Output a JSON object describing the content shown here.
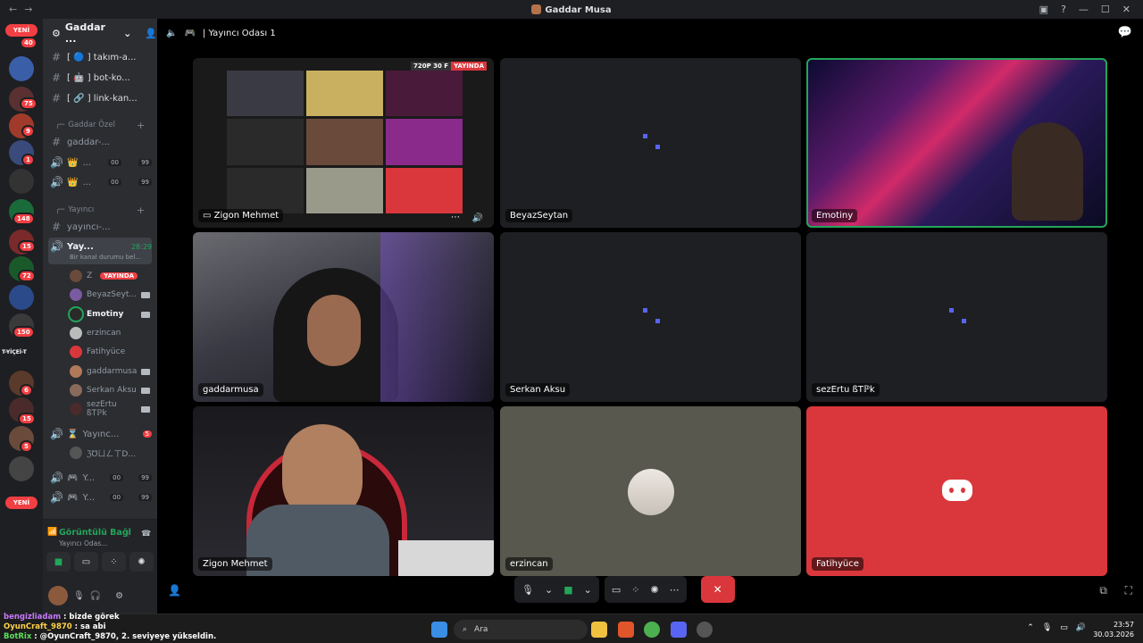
{
  "window": {
    "title": "Gaddar Musa"
  },
  "rail": {
    "new_top": "YENİ",
    "new_bottom": "YENİ",
    "badges": [
      "40",
      "75",
      "9",
      "1",
      "148",
      "15",
      "72",
      "150",
      "6",
      "15",
      "5"
    ],
    "text_server": "T-YİÇEİ-T"
  },
  "server": {
    "name": "Gaddar ...",
    "channels": [
      {
        "name": "[ 🔵 ] takım-a..."
      },
      {
        "name": "[ 🤖 ] bot-ko..."
      },
      {
        "name": "[ 🔗 ] link-kan..."
      }
    ],
    "categories": [
      {
        "label": "Gaddar Özel"
      },
      {
        "label": "Yayıncı"
      }
    ],
    "private_text": "gaddar-...",
    "private_voice": [
      {
        "label": "...",
        "count": "00",
        "cap": "99"
      },
      {
        "label": "...",
        "count": "00",
        "cap": "99"
      }
    ],
    "streamer_text": "yayıncı-...",
    "active_voice": {
      "name": "Yay...",
      "time": "28:29",
      "status": "Bir kanal durumu bel..."
    },
    "members": [
      {
        "name": "Z",
        "live": "YAYINDA"
      },
      {
        "name": "BeyazSeyt..."
      },
      {
        "name": "Emotiny"
      },
      {
        "name": "erzincan"
      },
      {
        "name": "Fatihyüce"
      },
      {
        "name": "gaddarmusa"
      },
      {
        "name": "Serkan Aksu"
      },
      {
        "name": "sezErtu ßTℙk"
      }
    ],
    "voice2": {
      "name": "Yayınc...",
      "count": "5",
      "member": "ℨ℧ㄩㄥㄒD..."
    },
    "bottom_voice": [
      {
        "label": "Y...",
        "count": "00",
        "cap": "99"
      },
      {
        "label": "Y...",
        "count": "00",
        "cap": "99"
      }
    ]
  },
  "voice_panel": {
    "status": "Görüntülü Bağl",
    "channel": "Yayıncı Odas..."
  },
  "call": {
    "channel": "| Yayıncı Odası 1",
    "stream_quality": "720P 30 F",
    "stream_live": "YAYINDA",
    "tiles": [
      {
        "name": "Zigon Mehmet",
        "kind": "stream"
      },
      {
        "name": "BeyazSeytan",
        "kind": "empty"
      },
      {
        "name": "Emotiny",
        "kind": "cam-galaxy",
        "speaking": true
      },
      {
        "name": "gaddarmusa",
        "kind": "cam-room"
      },
      {
        "name": "Serkan Aksu",
        "kind": "empty"
      },
      {
        "name": "sezErtu ßTℙk",
        "kind": "empty"
      },
      {
        "name": "Zigon Mehmet",
        "kind": "cam-chair"
      },
      {
        "name": "erzincan",
        "kind": "avatar"
      },
      {
        "name": "Fatihyüce",
        "kind": "discord"
      }
    ]
  },
  "chat_overlay": [
    {
      "user": "bengizliadam",
      "msg": " : bizde görek"
    },
    {
      "user": "OyunCraft_9870",
      "msg": " : sa abi"
    },
    {
      "user": "BotRix",
      "msg": " : @OyunCraft_9870, 2. seviyeye yükseldin."
    }
  ],
  "taskbar": {
    "search_placeholder": "Ara",
    "time": "23:57",
    "date": "30.03.2026"
  }
}
